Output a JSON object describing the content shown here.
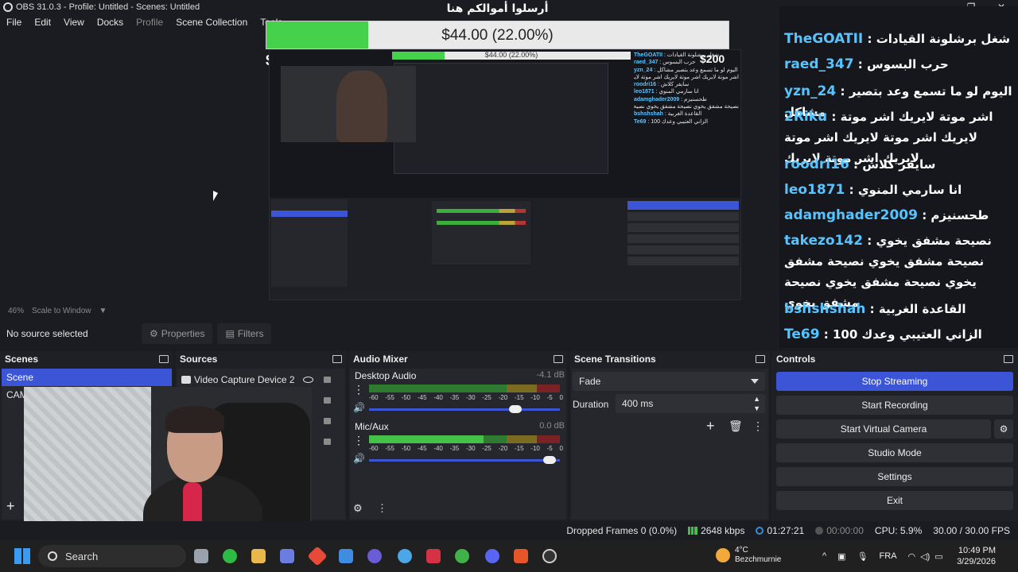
{
  "window": {
    "title": "OBS 31.0.3 - Profile: Untitled - Scenes: Untitled",
    "controls": [
      "—",
      "❐",
      "✕"
    ]
  },
  "menu": [
    "File",
    "Edit",
    "View",
    "Docks",
    "Profile",
    "Scene Collection",
    "Tools"
  ],
  "donation": {
    "title": "أرسلوا أموالكم هنا",
    "amount_label": "$44.00 (22.00%)",
    "progress": 0.22,
    "min_label": "$0",
    "max_label": "$200"
  },
  "nested_preview": {
    "amount_label": "$44.00 (22.00%)"
  },
  "chat": [
    {
      "name": "TheGOATII",
      "msg": "شغل برشلونة القيادات"
    },
    {
      "name": "raed_347",
      "msg": "حرب البسوس"
    },
    {
      "name": "yzn_24",
      "msg": "اليوم لو ما تسمع وعد بتصير مشاكل"
    },
    {
      "name": "2Riku",
      "msg": "اشر موتة لايريك اشر موتة لايريك اشر موتة لايريك اشر موتة لايريك اشر موتة لايريك"
    },
    {
      "name": "roodri16",
      "msg": "سايفر كلاش"
    },
    {
      "name": "leo1871",
      "msg": "انا سارمي المنوي"
    },
    {
      "name": "adamghader2009",
      "msg": "طحسنيزم"
    },
    {
      "name": "takezo142",
      "msg": "نصيحة مشفق يخوي نصيحة مشفق يخوي نصيحة مشفق يخوي نصيحة مشفق يخوي نصيحة مشفق يخوي"
    },
    {
      "name": "bshshshah",
      "msg": "القاعدة الغربية"
    },
    {
      "name": "Te69",
      "msg": "الزاني العتيبي وعدك 100"
    }
  ],
  "zoom": {
    "percent": "46%",
    "mode": "Scale to Window"
  },
  "source_toolbar": {
    "no_source": "No source selected",
    "properties": "Properties",
    "filters": "Filters"
  },
  "scenes": {
    "title": "Scenes",
    "items": [
      "Scene",
      "CAM"
    ]
  },
  "sources": {
    "title": "Sources",
    "items": [
      "Video Capture Device 2"
    ]
  },
  "mixer": {
    "title": "Audio Mixer",
    "ticks": [
      "-60",
      "-55",
      "-50",
      "-45",
      "-40",
      "-35",
      "-30",
      "-25",
      "-20",
      "-15",
      "-10",
      "-5",
      "0"
    ],
    "tracks": [
      {
        "name": "Desktop Audio",
        "level": "-4.1 dB",
        "meter": 0.0,
        "volume": 0.8
      },
      {
        "name": "Mic/Aux",
        "level": "0.0 dB",
        "meter": 0.6,
        "volume": 0.98
      }
    ]
  },
  "transitions": {
    "title": "Scene Transitions",
    "selected": "Fade",
    "duration_label": "Duration",
    "duration_value": "400 ms"
  },
  "controls": {
    "title": "Controls",
    "buttons": [
      "Stop Streaming",
      "Start Recording",
      "Start Virtual Camera",
      "Studio Mode",
      "Settings",
      "Exit"
    ]
  },
  "status": {
    "dropped": "Dropped Frames 0 (0.0%)",
    "bitrate": "2648 kbps",
    "stream_time": "01:27:21",
    "rec_time": "00:00:00",
    "cpu": "CPU: 5.9%",
    "fps": "30.00 / 30.00 FPS"
  },
  "taskbar": {
    "search": "Search",
    "weather_temp": "4°C",
    "weather_loc": "Bezchmurnie",
    "lang": "FRA",
    "time": "10:49 PM",
    "date": "3/29/2026"
  },
  "colors": {
    "accent": "#3b55d6",
    "green": "#46d14d",
    "chat_name": "#58c4ff"
  }
}
